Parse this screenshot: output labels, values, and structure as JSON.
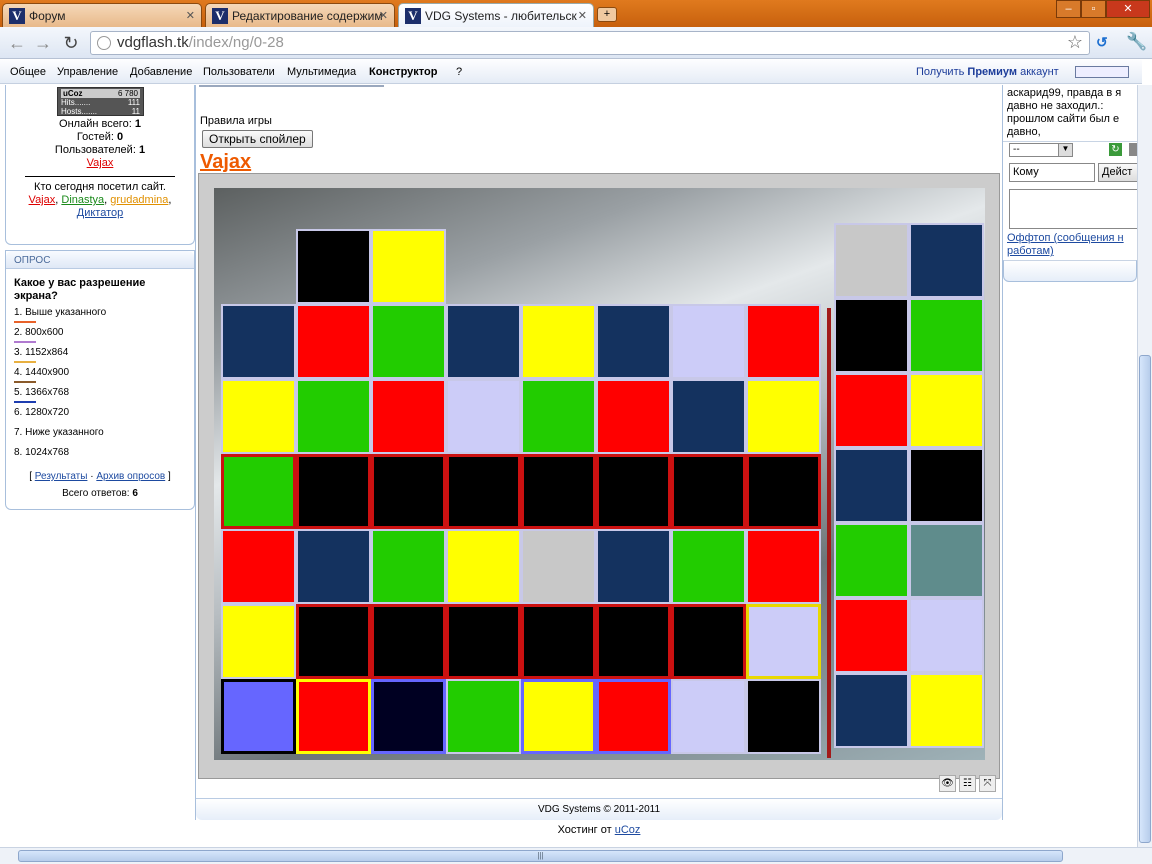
{
  "browser": {
    "tabs": [
      {
        "title": "Форум"
      },
      {
        "title": "Редактирование содержим"
      },
      {
        "title": "VDG Systems - любительск"
      }
    ],
    "new_tab": "+",
    "url_host": "vdgflash.tk",
    "url_path": "/index/ng/0-28",
    "window_controls": [
      "–",
      "▫",
      "✕"
    ]
  },
  "adminbar": {
    "items": [
      "Общее",
      "Управление",
      "Добавление",
      "Пользователи",
      "Мультимедиа",
      "Конструктор",
      "?"
    ],
    "premium_prefix": "Получить",
    "premium_bold": "Премиум",
    "premium_suffix": "аккаунт"
  },
  "left_stats": {
    "counter_brand": "uCoz",
    "counter_value": "6 780",
    "hits_label": "Hits.......",
    "hits_value": "111",
    "hosts_label": "Hosts.......",
    "hosts_value": "11",
    "online_label": "Онлайн всего:",
    "online_value": "1",
    "guests_label": "Гостей:",
    "guests_value": "0",
    "users_label": "Пользователей:",
    "users_value": "1",
    "user_link": "Vajax",
    "today_title": "Кто сегодня посетил сайт.",
    "visitors": [
      "Vajax",
      "Dinastya",
      "grudadmina",
      "Диктатор"
    ]
  },
  "poll": {
    "header": "ОПРОС",
    "question": "Какое у вас разрешение экрана?",
    "options": [
      {
        "label": "1. Выше указанного",
        "color": "#e8622a"
      },
      {
        "label": "2. 800x600",
        "color": "#b07ad0"
      },
      {
        "label": "3. 1152x864",
        "color": "#e8b040"
      },
      {
        "label": "4. 1440x900",
        "color": "#8a5a2a"
      },
      {
        "label": "5. 1366x768",
        "color": "#1d3db0"
      },
      {
        "label": "6. 1280x720",
        "color": ""
      },
      {
        "label": "7. Ниже указанного",
        "color": ""
      },
      {
        "label": "8. 1024x768",
        "color": ""
      }
    ],
    "results_link": "Результаты",
    "archive_link": "Архив опросов",
    "total_label": "Всего ответов:",
    "total_value": "6"
  },
  "main": {
    "rules_label": "Правила игры",
    "spoiler_button": "Открыть спойлер",
    "game_title": "Vajax",
    "footer_copyright": "VDG Systems © 2011-2011",
    "hosting_prefix": "Хостинг от",
    "hosting_link": "uCoz"
  },
  "game": {
    "cells": [
      {
        "col": 1,
        "row": 0,
        "color": "#000000"
      },
      {
        "col": 2,
        "row": 0,
        "color": "#ffff00"
      },
      {
        "col": 0,
        "row": 1,
        "color": "#14325f"
      },
      {
        "col": 1,
        "row": 1,
        "color": "#ff0000"
      },
      {
        "col": 2,
        "row": 1,
        "color": "#22cc00"
      },
      {
        "col": 3,
        "row": 1,
        "color": "#14325f"
      },
      {
        "col": 4,
        "row": 1,
        "color": "#ffff00"
      },
      {
        "col": 5,
        "row": 1,
        "color": "#14325f"
      },
      {
        "col": 6,
        "row": 1,
        "color": "#ccccf8"
      },
      {
        "col": 7,
        "row": 1,
        "color": "#ff0000"
      },
      {
        "col": 0,
        "row": 2,
        "color": "#ffff00"
      },
      {
        "col": 1,
        "row": 2,
        "color": "#22cc00"
      },
      {
        "col": 2,
        "row": 2,
        "color": "#ff0000"
      },
      {
        "col": 3,
        "row": 2,
        "color": "#ccccf8"
      },
      {
        "col": 4,
        "row": 2,
        "color": "#22cc00"
      },
      {
        "col": 5,
        "row": 2,
        "color": "#ff0000"
      },
      {
        "col": 6,
        "row": 2,
        "color": "#14325f"
      },
      {
        "col": 7,
        "row": 2,
        "color": "#ffff00"
      },
      {
        "col": 0,
        "row": 3,
        "color": "#22cc00",
        "border": "#cc1111"
      },
      {
        "col": 1,
        "row": 3,
        "color": "#000000",
        "border": "#cc1111"
      },
      {
        "col": 2,
        "row": 3,
        "color": "#000000",
        "border": "#cc1111"
      },
      {
        "col": 3,
        "row": 3,
        "color": "#000000",
        "border": "#cc1111"
      },
      {
        "col": 4,
        "row": 3,
        "color": "#000000",
        "border": "#cc1111"
      },
      {
        "col": 5,
        "row": 3,
        "color": "#000000",
        "border": "#cc1111"
      },
      {
        "col": 6,
        "row": 3,
        "color": "#000000",
        "border": "#cc1111"
      },
      {
        "col": 7,
        "row": 3,
        "color": "#000000",
        "border": "#cc1111"
      },
      {
        "col": 0,
        "row": 4,
        "color": "#ff0000"
      },
      {
        "col": 1,
        "row": 4,
        "color": "#14325f"
      },
      {
        "col": 2,
        "row": 4,
        "color": "#22cc00"
      },
      {
        "col": 3,
        "row": 4,
        "color": "#ffff00"
      },
      {
        "col": 4,
        "row": 4,
        "color": "#c8c8c8"
      },
      {
        "col": 5,
        "row": 4,
        "color": "#14325f"
      },
      {
        "col": 6,
        "row": 4,
        "color": "#22cc00"
      },
      {
        "col": 7,
        "row": 4,
        "color": "#ff0000"
      },
      {
        "col": 0,
        "row": 5,
        "color": "#ffff00"
      },
      {
        "col": 1,
        "row": 5,
        "color": "#000000",
        "border": "#cc1111"
      },
      {
        "col": 2,
        "row": 5,
        "color": "#000000",
        "border": "#cc1111"
      },
      {
        "col": 3,
        "row": 5,
        "color": "#000000",
        "border": "#cc1111"
      },
      {
        "col": 4,
        "row": 5,
        "color": "#000000",
        "border": "#cc1111"
      },
      {
        "col": 5,
        "row": 5,
        "color": "#000000",
        "border": "#cc1111"
      },
      {
        "col": 6,
        "row": 5,
        "color": "#000000",
        "border": "#cc1111"
      },
      {
        "col": 7,
        "row": 5,
        "color": "#ccccf8",
        "border": "#e8d800"
      },
      {
        "col": 0,
        "row": 6,
        "color": "#6666ff",
        "border": "#000000"
      },
      {
        "col": 1,
        "row": 6,
        "color": "#ff0000",
        "border": "#ffff00"
      },
      {
        "col": 2,
        "row": 6,
        "color": "#000022",
        "border": "#6666ff"
      },
      {
        "col": 3,
        "row": 6,
        "color": "#22cc00"
      },
      {
        "col": 4,
        "row": 6,
        "color": "#ffff00",
        "border": "#6666ff"
      },
      {
        "col": 5,
        "row": 6,
        "color": "#ff0000",
        "border": "#6666ff"
      },
      {
        "col": 6,
        "row": 6,
        "color": "#ccccf8"
      },
      {
        "col": 7,
        "row": 6,
        "color": "#000000"
      }
    ],
    "side_cells": [
      {
        "col": 0,
        "row": 0,
        "color": "#c8c8c8"
      },
      {
        "col": 1,
        "row": 0,
        "color": "#14325f"
      },
      {
        "col": 0,
        "row": 1,
        "color": "#000000"
      },
      {
        "col": 1,
        "row": 1,
        "color": "#22cc00"
      },
      {
        "col": 0,
        "row": 2,
        "color": "#ff0000"
      },
      {
        "col": 1,
        "row": 2,
        "color": "#ffff00"
      },
      {
        "col": 0,
        "row": 3,
        "color": "#14325f"
      },
      {
        "col": 1,
        "row": 3,
        "color": "#000000"
      },
      {
        "col": 0,
        "row": 4,
        "color": "#22cc00"
      },
      {
        "col": 1,
        "row": 4,
        "color": "#5f8c8c"
      },
      {
        "col": 0,
        "row": 5,
        "color": "#ff0000"
      },
      {
        "col": 1,
        "row": 5,
        "color": "#ccccf8"
      },
      {
        "col": 0,
        "row": 6,
        "color": "#14325f"
      },
      {
        "col": 1,
        "row": 6,
        "color": "#ffff00"
      }
    ],
    "controls": [
      "👁",
      "☷",
      "⤧"
    ]
  },
  "chat": {
    "message": "аскарид99, правда в я давно не заходил.: прошлом сайти был е давно,",
    "select_value": "--",
    "to_placeholder": "Кому",
    "action_label": "Дейст",
    "offtop_link": "Оффтоп (сообщения н работам)"
  },
  "scrollbar": {
    "h_grip": "|||"
  }
}
